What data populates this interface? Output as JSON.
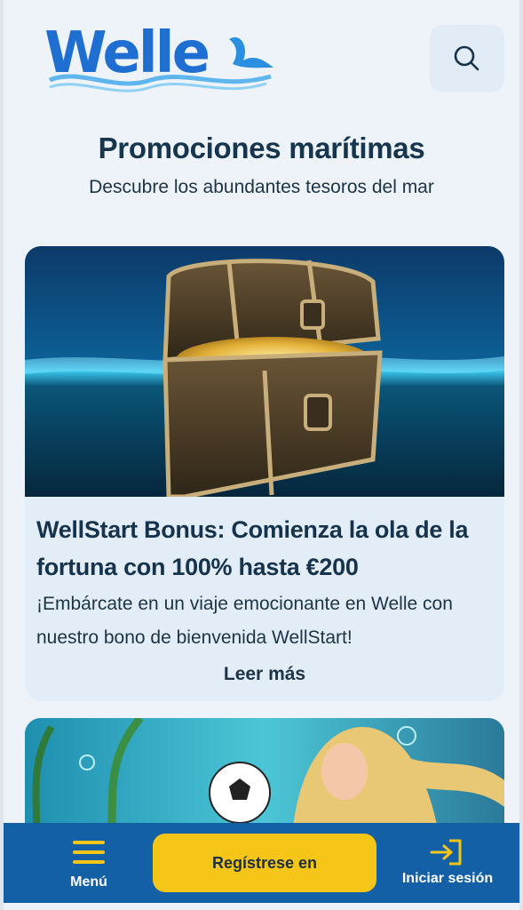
{
  "header": {
    "logo_text": "Welle",
    "search_icon": "search-icon"
  },
  "page": {
    "title": "Promociones marítimas",
    "subtitle": "Descubre los abundantes tesoros del mar"
  },
  "promos": [
    {
      "image": "treasure-chest-image",
      "title": "WellStart Bonus: Comienza la ola de la fortuna con 100% hasta €200",
      "description": "¡Embárcate en un viaje emocionante en Welle con nuestro bono de bienvenida WellStart!",
      "link_label": "Leer más"
    },
    {
      "image": "mermaid-football-image"
    }
  ],
  "bottom_bar": {
    "menu_label": "Menú",
    "register_label": "Regístrese en",
    "login_label": "Iniciar sesión"
  },
  "colors": {
    "brand_blue": "#1f6fd3",
    "bottom_bar": "#1460a6",
    "cta_yellow": "#f5c518",
    "text_dark": "#16364f"
  }
}
